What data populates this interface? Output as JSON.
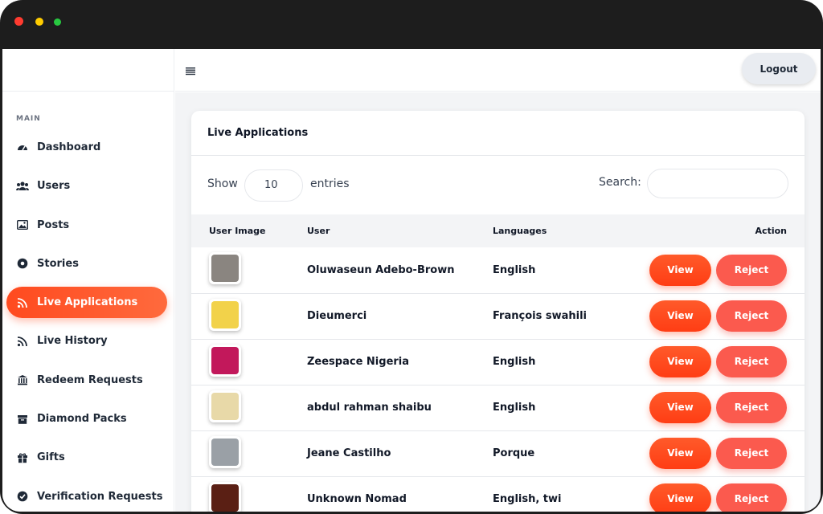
{
  "sidebar": {
    "section_title": "MAIN",
    "items": [
      {
        "label": "Dashboard",
        "icon": "gauge-icon"
      },
      {
        "label": "Users",
        "icon": "users-icon"
      },
      {
        "label": "Posts",
        "icon": "image-icon"
      },
      {
        "label": "Stories",
        "icon": "circle-play-icon"
      },
      {
        "label": "Live Applications",
        "icon": "rss-icon",
        "active": true
      },
      {
        "label": "Live History",
        "icon": "rss-icon"
      },
      {
        "label": "Redeem Requests",
        "icon": "bank-icon"
      },
      {
        "label": "Diamond Packs",
        "icon": "box-icon"
      },
      {
        "label": "Gifts",
        "icon": "gift-icon"
      },
      {
        "label": "Verification Requests",
        "icon": "check-circle-icon"
      }
    ]
  },
  "topbar": {
    "logout_label": "Logout",
    "menu_icon": "hamburger-icon"
  },
  "card": {
    "title": "Live Applications",
    "show_label": "Show",
    "entries_value": "10",
    "entries_label": "entries",
    "search_label": "Search:",
    "search_value": ""
  },
  "table": {
    "columns": [
      "User Image",
      "User",
      "Languages",
      "Action"
    ],
    "rows": [
      {
        "user": "Oluwaseun Adebo-Brown",
        "languages": "English",
        "thumb_color": "#8a8580"
      },
      {
        "user": "Dieumerci",
        "languages": "François swahili",
        "thumb_color": "#f2d24a"
      },
      {
        "user": "Zeespace Nigeria",
        "languages": "English",
        "thumb_color": "#c2185b"
      },
      {
        "user": "abdul rahman shaibu",
        "languages": "English",
        "thumb_color": "#e8d9a8"
      },
      {
        "user": "Jeane Castilho",
        "languages": "Porque",
        "thumb_color": "#9aa0a6"
      },
      {
        "user": "Unknown Nomad",
        "languages": "English, twi",
        "thumb_color": "#5a1f14"
      }
    ],
    "view_label": "View",
    "reject_label": "Reject"
  },
  "colors": {
    "accent": "#ff4a1f",
    "reject": "#fb5a4e",
    "frame": "#1d1d1d"
  }
}
